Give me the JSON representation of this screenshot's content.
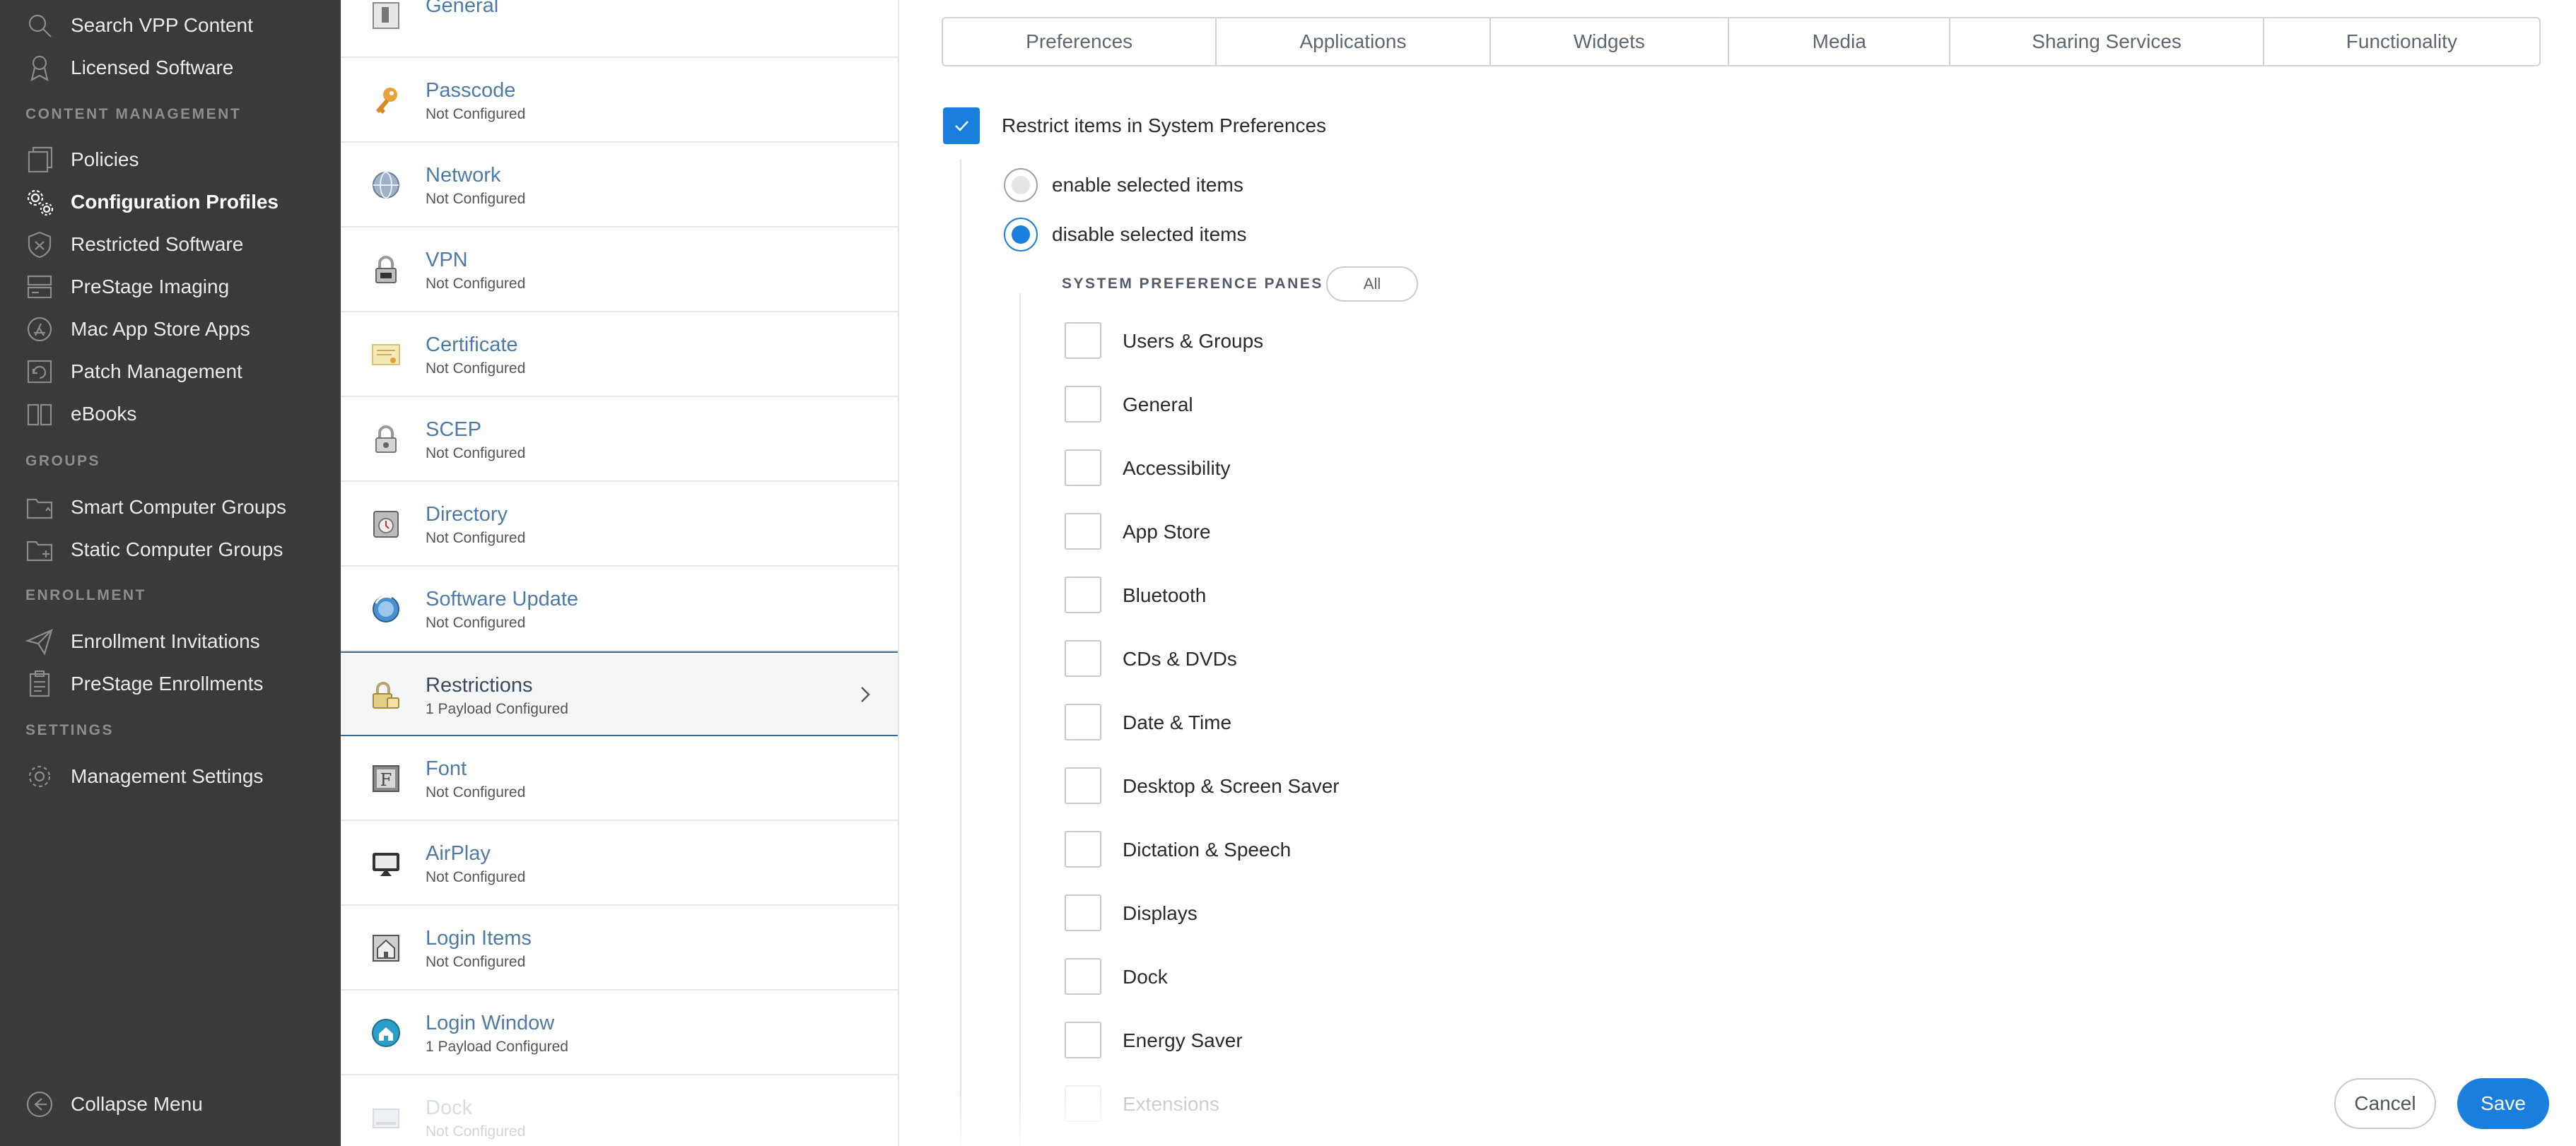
{
  "sidebar": {
    "items_top": [
      {
        "label": "Search VPP Content",
        "icon": "search-icon"
      },
      {
        "label": "Licensed Software",
        "icon": "license-icon"
      }
    ],
    "sections": [
      {
        "title": "CONTENT MANAGEMENT"
      },
      {
        "title": "GROUPS"
      },
      {
        "title": "ENROLLMENT"
      },
      {
        "title": "SETTINGS"
      }
    ],
    "content_items": [
      {
        "label": "Policies",
        "icon": "policies-icon"
      },
      {
        "label": "Configuration Profiles",
        "icon": "gear-icon",
        "active": true
      },
      {
        "label": "Restricted Software",
        "icon": "shield-icon"
      },
      {
        "label": "PreStage Imaging",
        "icon": "imaging-icon"
      },
      {
        "label": "Mac App Store Apps",
        "icon": "app-store-icon"
      },
      {
        "label": "Patch Management",
        "icon": "patch-icon"
      },
      {
        "label": "eBooks",
        "icon": "book-icon"
      }
    ],
    "group_items": [
      {
        "label": "Smart Computer Groups",
        "icon": "smart-group-icon"
      },
      {
        "label": "Static Computer Groups",
        "icon": "static-group-icon"
      }
    ],
    "enrollment_items": [
      {
        "label": "Enrollment Invitations",
        "icon": "send-icon"
      },
      {
        "label": "PreStage Enrollments",
        "icon": "clipboard-icon"
      }
    ],
    "settings_items": [
      {
        "label": "Management Settings",
        "icon": "gear-icon"
      }
    ],
    "collapse_label": "Collapse Menu"
  },
  "payloads": [
    {
      "name": "General",
      "status": "",
      "icon": "general-icon"
    },
    {
      "name": "Passcode",
      "status": "Not Configured",
      "icon": "key-icon"
    },
    {
      "name": "Network",
      "status": "Not Configured",
      "icon": "globe-icon"
    },
    {
      "name": "VPN",
      "status": "Not Configured",
      "icon": "lock-icon"
    },
    {
      "name": "Certificate",
      "status": "Not Configured",
      "icon": "certificate-icon"
    },
    {
      "name": "SCEP",
      "status": "Not Configured",
      "icon": "scep-icon"
    },
    {
      "name": "Directory",
      "status": "Not Configured",
      "icon": "directory-icon"
    },
    {
      "name": "Software Update",
      "status": "Not Configured",
      "icon": "software-update-icon"
    },
    {
      "name": "Restrictions",
      "status": "1 Payload Configured",
      "icon": "restrictions-lock-icon",
      "active": true
    },
    {
      "name": "Font",
      "status": "Not Configured",
      "icon": "font-icon"
    },
    {
      "name": "AirPlay",
      "status": "Not Configured",
      "icon": "airplay-icon"
    },
    {
      "name": "Login Items",
      "status": "Not Configured",
      "icon": "login-items-icon"
    },
    {
      "name": "Login Window",
      "status": "1 Payload Configured",
      "icon": "login-window-icon"
    },
    {
      "name": "Dock",
      "status": "Not Configured",
      "icon": "dock-icon"
    }
  ],
  "tabs": [
    "Preferences",
    "Applications",
    "Widgets",
    "Media",
    "Sharing Services",
    "Functionality"
  ],
  "active_tab": "Preferences",
  "restrict": {
    "label": "Restrict items in System Preferences",
    "checked": true,
    "radio_enable": "enable selected items",
    "radio_disable": "disable selected items",
    "selected": "disable"
  },
  "panes": {
    "title": "SYSTEM PREFERENCE PANES",
    "all_button": "All",
    "items": [
      "Users & Groups",
      "General",
      "Accessibility",
      "App Store",
      "Bluetooth",
      "CDs & DVDs",
      "Date & Time",
      "Desktop & Screen Saver",
      "Dictation & Speech",
      "Displays",
      "Dock",
      "Energy Saver",
      "Extensions"
    ]
  },
  "buttons": {
    "cancel": "Cancel",
    "save": "Save"
  },
  "colors": {
    "accent": "#1a7fdc",
    "sidebar_bg": "#3a3a3a",
    "link": "#4d7aa6"
  }
}
